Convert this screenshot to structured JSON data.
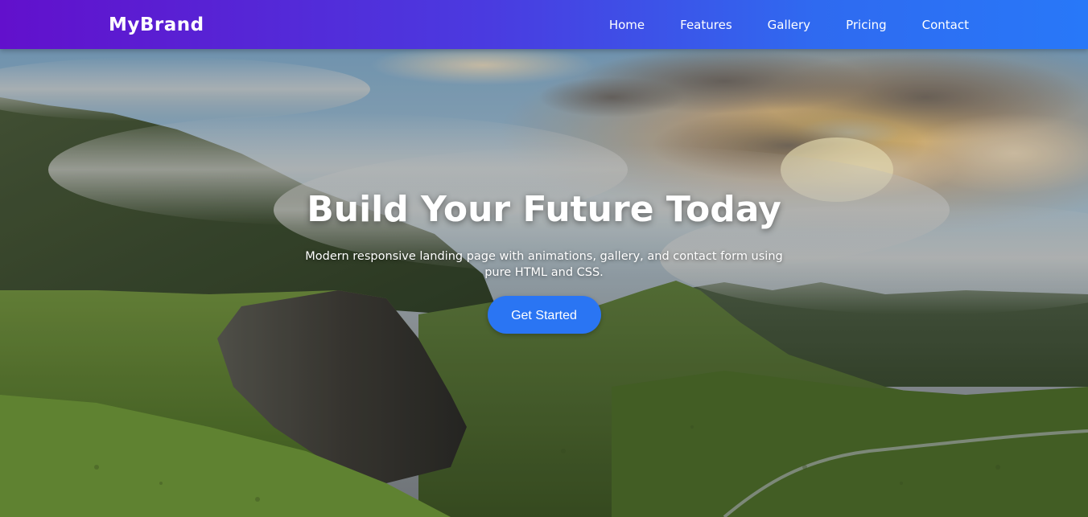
{
  "navbar": {
    "brand": "MyBrand",
    "links": [
      {
        "label": "Home"
      },
      {
        "label": "Features"
      },
      {
        "label": "Gallery"
      },
      {
        "label": "Pricing"
      },
      {
        "label": "Contact"
      }
    ],
    "gradient_start": "#6210cc",
    "gradient_end": "#2878f8"
  },
  "hero": {
    "title": "Build Your Future Today",
    "subtitle": "Modern responsive landing page with animations, gallery, and contact form using pure HTML and CSS.",
    "cta_label": "Get Started",
    "cta_color": "#2a75f3",
    "background": "mountain-valley-sunrise-photo"
  }
}
